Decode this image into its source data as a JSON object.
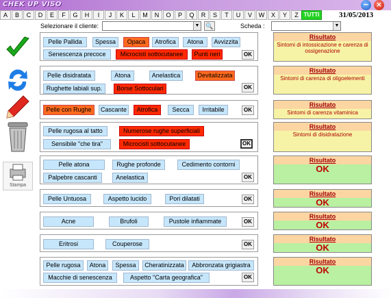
{
  "app": {
    "title": "CHEK UP VISO",
    "min_icon": "minimize-icon",
    "close_icon": "close-icon"
  },
  "date": "31/05/2013",
  "letters": [
    "A",
    "B",
    "C",
    "D",
    "E",
    "F",
    "G",
    "H",
    "I",
    "J",
    "K",
    "L",
    "M",
    "N",
    "O",
    "P",
    "Q",
    "R",
    "S",
    "T",
    "U",
    "V",
    "W",
    "X",
    "Y",
    "Z"
  ],
  "tutti": "TUTTI",
  "client_label": "Selezionare il cliente:",
  "scheda_label": "Scheda :",
  "client_value": "",
  "scheda_value": "",
  "sidebar": {
    "stampa_label": "Stampa"
  },
  "groups": [
    {
      "chips": [
        "Pelle Pallida",
        "Spessa",
        "Opaca",
        "Atrofica",
        "Atona",
        "Avvizzita",
        "Senescenza precoce",
        "Microcisti sottocutanee",
        "Punti neri"
      ],
      "ok": "OK"
    },
    {
      "chips": [
        "Pelle disidratata",
        "Atona",
        "Anelastica",
        "Devitalizzata",
        "Rughette labiali sup.",
        "Borse Sottoculari"
      ],
      "ok": "OK"
    },
    {
      "chips": [
        "Pelle con Rughe",
        "Cascante",
        "Atrofica",
        "Secca",
        "Irritabile"
      ],
      "ok": "OK"
    },
    {
      "chips": [
        "Pelle rugosa al tatto",
        "Numerose rughe superficiali",
        "Sensibile \"che tira\"",
        "Microcisti sottocutanee"
      ],
      "ok": "OK"
    },
    {
      "chips": [
        "Pelle atona",
        "Rughe profonde",
        "Cedimento contorni",
        "Palpebre cascanti",
        "Anelastica"
      ],
      "ok": "OK"
    },
    {
      "chips": [
        "Pelle Untuosa",
        "Aspetto lucido",
        "Pori dilatati"
      ],
      "ok": "OK"
    },
    {
      "chips": [
        "Acne",
        "Brufoli",
        "Pustole infiammate"
      ],
      "ok": "OK"
    },
    {
      "chips": [
        "Eritrosi",
        "Couperose"
      ],
      "ok": "OK"
    },
    {
      "chips": [
        "Pelle rugosa",
        "Atona",
        "Spessa",
        "Cheratinizzata",
        "Abbronzata grigiastra",
        "Macchie di senescenza",
        "Aspetto \"Carta geografica\""
      ],
      "ok": "OK"
    }
  ],
  "results": [
    {
      "title": "Risultato",
      "text": "Sintomi di intossicazione e carenza di ossigenazione"
    },
    {
      "title": "Risultato",
      "text": "Sintomi di carenza di oligoelementi"
    },
    {
      "title": "Risultato",
      "text": "Sintomi di carenza vitaminica"
    },
    {
      "title": "Risultato",
      "text": "Sintomi di disidratazione"
    },
    {
      "title": "Risultato",
      "text": "OK"
    },
    {
      "title": "Risultato",
      "text": "OK"
    },
    {
      "title": "Risultato",
      "text": "OK"
    },
    {
      "title": "Risultato",
      "text": "OK"
    },
    {
      "title": "Risultato",
      "text": "OK"
    }
  ]
}
